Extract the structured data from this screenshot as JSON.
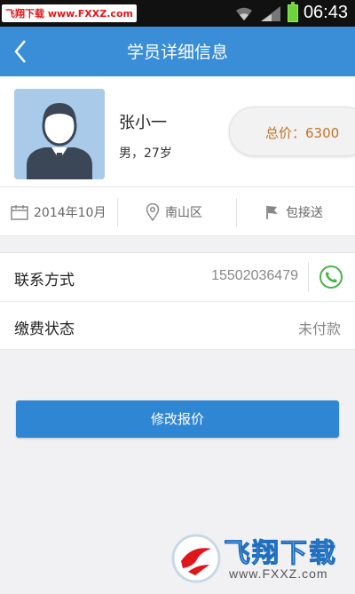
{
  "status_bar": {
    "watermark": "飞翔下载 www.FXXZ.com",
    "time": "06:43",
    "battery_color": "#6ed33a"
  },
  "header": {
    "title": "学员详细信息",
    "back_icon": "chevron-left-icon",
    "background": "#3a8ed7"
  },
  "student": {
    "name": "张小一",
    "gender_age": "男，27岁",
    "price_text": "总价：6300",
    "avatar_icon": "user-avatar-icon"
  },
  "info": {
    "date": "2014年10月",
    "district": "南山区",
    "pickup": "包接送",
    "icons": [
      "calendar-icon",
      "location-pin-icon",
      "flag-icon"
    ]
  },
  "contact": {
    "phone_label": "联系方式",
    "phone_value": "15502036479",
    "payment_label": "缴费状态",
    "payment_value": "未付款",
    "phone_icon": "phone-icon"
  },
  "action": {
    "label": "修改报价",
    "color": "#2f87d4"
  },
  "watermark": {
    "title": "飞翔下载",
    "url": "www.FXXZ.com"
  }
}
